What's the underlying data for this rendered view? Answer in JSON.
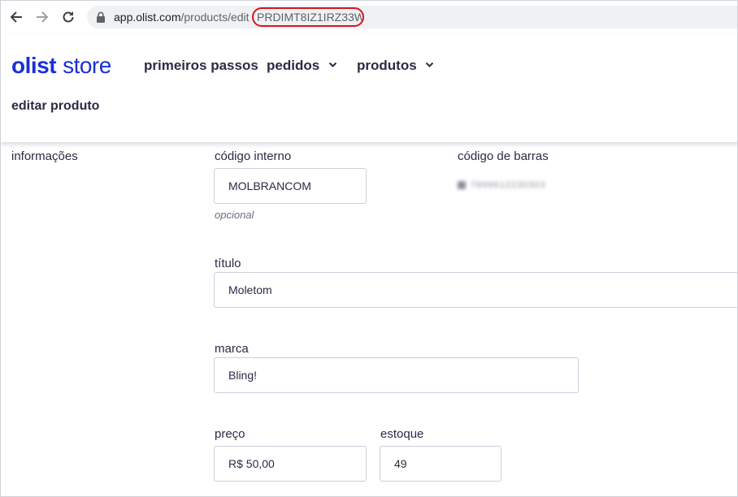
{
  "browser": {
    "url_host": "app.olist.com",
    "url_path": "/products/edit",
    "url_id": "PRDIMT8IZ1IRZ33W"
  },
  "header": {
    "logo_primary": "olist",
    "logo_secondary": "store",
    "nav": [
      {
        "label": "primeiros passos"
      },
      {
        "label": "pedidos"
      },
      {
        "label": "produtos"
      }
    ],
    "page_title": "editar produto"
  },
  "form": {
    "section": "informações",
    "internal_code": {
      "label": "código interno",
      "value": "MOLBRANCOM",
      "hint": "opcional"
    },
    "barcode": {
      "label": "código de barras",
      "value": "7899612230303"
    },
    "title": {
      "label": "título",
      "value": "Moletom"
    },
    "brand": {
      "label": "marca",
      "value": "Bling!"
    },
    "price": {
      "label": "preço",
      "value": "R$ 50,00"
    },
    "stock": {
      "label": "estoque",
      "value": "49"
    }
  },
  "colors": {
    "brand": "#1a30d6",
    "highlight": "#d9141c",
    "text": "#2b2b44"
  }
}
